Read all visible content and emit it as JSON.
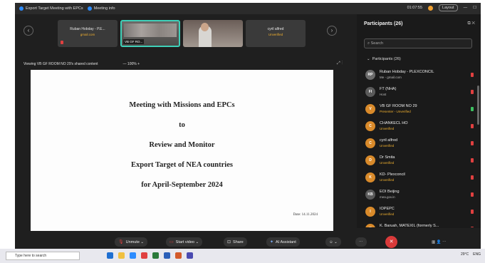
{
  "titlebar": {
    "meeting_tab": "Export Target Meeting with EPCs",
    "info_tab": "Meeting info",
    "timer": "01:07:55",
    "layout_label": "Layout"
  },
  "thumbnails": [
    {
      "name": "Ruban Hobday - P.E...",
      "sub": "gmail.com"
    },
    {
      "name": "VB GF ROOM NO 29",
      "label": "VB GF RO..."
    },
    {
      "name": "",
      "sub": ""
    },
    {
      "name": "cyril alfred",
      "sub": "Unverified"
    }
  ],
  "viewbar": {
    "text": "Viewing VB GF ROOM NO 29's shared content",
    "zoom": "100%"
  },
  "slide": {
    "lines": [
      "Meeting with Missions and EPCs",
      "to",
      "Review and Monitor",
      "Export Target of NEA countries",
      "for April-September 2024"
    ],
    "date": "Date: 14.11.2024"
  },
  "panel": {
    "title": "Participants (26)",
    "search_placeholder": "Search",
    "section": "Participants (26)",
    "participants": [
      {
        "initials": "RP",
        "name": "Ruban Hobday - PLEXCONCIL",
        "sub": "Me - gmail.com",
        "color": "#6b6b6b",
        "subcolor": "#bbbbbb",
        "mic": "#e04040"
      },
      {
        "initials": "FI",
        "name": "FT (NHA)",
        "sub": "Host",
        "color": "#5a5a5a",
        "subcolor": "#bbbbbb",
        "mic": "#e04040"
      },
      {
        "initials": "V",
        "name": "VB GF ROOM NO 29",
        "sub": "Presenter - Unverified",
        "color": "#d98a2a",
        "subcolor": "#f0b030",
        "mic": "#3cc060"
      },
      {
        "initials": "C",
        "name": "CHANKECL HO",
        "sub": "Unverified",
        "color": "#d98a2a",
        "subcolor": "#f0b030",
        "mic": "#e04040"
      },
      {
        "initials": "C",
        "name": "cyril alfred",
        "sub": "Unverified",
        "color": "#d98a2a",
        "subcolor": "#f0b030",
        "mic": "#e04040"
      },
      {
        "initials": "D",
        "name": "Dr Smita",
        "sub": "Unverified",
        "color": "#d98a2a",
        "subcolor": "#f0b030",
        "mic": "#e04040"
      },
      {
        "initials": "K",
        "name": "KD- Plexconcil",
        "sub": "Unverified",
        "color": "#d98a2a",
        "subcolor": "#f0b030",
        "mic": "#e04040"
      },
      {
        "initials": "KB",
        "name": "EOI Beijing",
        "sub": "mea.gov.in",
        "color": "#5a5a5a",
        "subcolor": "#bbbbbb",
        "mic": "#e04040"
      },
      {
        "initials": "I",
        "name": "IOPEPC",
        "sub": "Unverified",
        "color": "#d98a2a",
        "subcolor": "#f0b030",
        "mic": "#e04040"
      },
      {
        "initials": "K",
        "name": "K. Baruah, MATEXIL (formerly S...",
        "sub": "Unverified",
        "color": "#d98a2a",
        "subcolor": "#f0b030",
        "mic": "#e04040"
      }
    ]
  },
  "toolbar": {
    "unmute": "Unmute",
    "start_video": "Start video",
    "share": "Share",
    "ai_assistant": "AI Assistant"
  },
  "taskbar": {
    "search_placeholder": "Type here to search",
    "weather": "29°C",
    "lang": "ENG"
  }
}
